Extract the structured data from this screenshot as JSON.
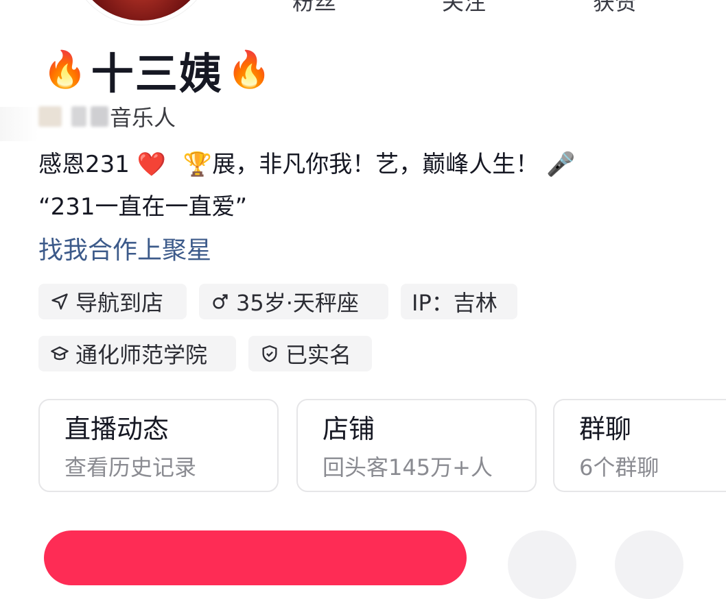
{
  "stats": {
    "fans_label": "粉丝",
    "follow_label": "关注",
    "likes_label": "获赞"
  },
  "profile": {
    "flame_left": "🔥",
    "name": "十三姨",
    "flame_right": "🔥",
    "identity": "音乐人"
  },
  "bio": {
    "line1_prefix": "感恩231",
    "heart": "❤️",
    "trophy": "🏆",
    "line1_suffix": "展，非凡你我！艺，巅峰人生！",
    "mic": "🎤",
    "line2": "“231一直在一直爱”",
    "cooperation_link": "找我合作上聚星"
  },
  "tags": {
    "navigate": "导航到店",
    "age_sign": "35岁·天秤座",
    "ip": "IP：吉林",
    "school": "通化师范学院",
    "verified": "已实名"
  },
  "cards": [
    {
      "title": "直播动态",
      "sub": "查看历史记录"
    },
    {
      "title": "店铺",
      "sub": "回头客145万+人"
    },
    {
      "title": "群聊",
      "sub": "6个群聊"
    }
  ],
  "colors": {
    "accent": "#fe2c55",
    "link": "#3c5a8a",
    "tag_bg": "#f4f4f5",
    "muted": "#8a8b91"
  },
  "icons": {
    "navigate": "navigation-arrow-icon",
    "gender": "male-icon",
    "school": "graduation-cap-icon",
    "verified": "shield-check-icon"
  }
}
